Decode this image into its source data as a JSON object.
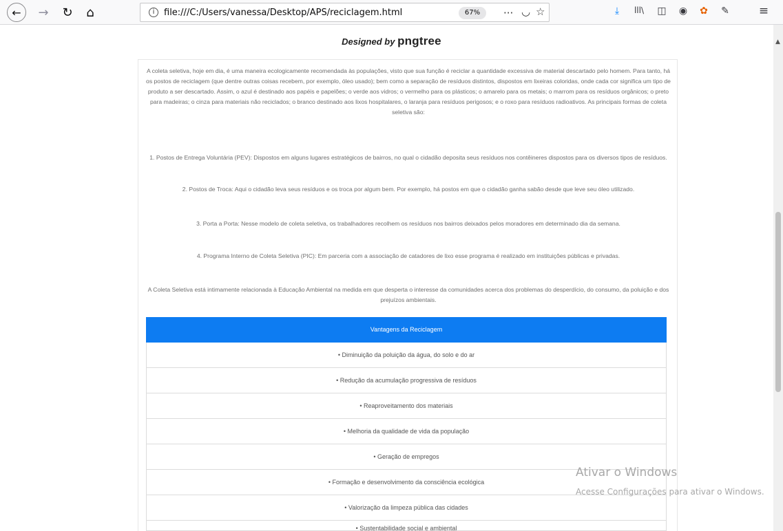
{
  "browser": {
    "back_icon": "←",
    "forward_icon": "→",
    "reload_icon": "↻",
    "home_icon": "⌂",
    "info_icon": "i",
    "url": "file:///C:/Users/vanessa/Desktop/APS/reciclagem.html",
    "zoom": "67%",
    "more_icon": "···",
    "pocket_icon": "◡",
    "bookmark_icon": "☆",
    "download_icon": "⤓",
    "library_icon": "lll\\",
    "sidebar_icon": "◫",
    "account_icon": "◉",
    "colorful_icon": "✿",
    "pen_icon": "✎",
    "menu_icon": "≡"
  },
  "page": {
    "designed_by": "Designed by",
    "brand": "pngtree",
    "intro": "A coleta seletiva, hoje em dia, é uma maneira ecologicamente recomendada às populações, visto que sua função é reciclar a quantidade excessiva de material descartado pelo homem. Para tanto, há os postos de reciclagem (que dentre outras coisas recebem, por exemplo, óleo usado); bem como a separação de resíduos distintos, dispostos em lixeiras coloridas, onde cada cor significa um tipo de produto a ser descartado. Assim, o azul é destinado aos papéis e papelões; o verde aos vidros; o vermelho para os plásticos; o amarelo para os metais; o marrom para os resíduos orgânicos; o preto para madeiras; o cinza para materiais não reciclados; o branco destinado aos lixos hospitalares, o laranja para resíduos perigosos; e o roxo para resíduos radioativos. As principais formas de coleta seletiva são:",
    "item1": "1. Postos de Entrega Voluntária (PEV): Dispostos em alguns lugares estratégicos de bairros, no qual o cidadão deposita seus resíduos nos contêineres dispostos para os diversos tipos de resíduos.",
    "item2": "2. Postos de Troca: Aqui o cidadão leva seus resíduos e os troca por algum bem. Por exemplo, há postos em que o cidadão ganha sabão desde que leve seu óleo utilizado.",
    "item3": "3. Porta a Porta: Nesse modelo de coleta seletiva, os trabalhadores recolhem os resíduos nos bairros deixados pelos moradores em determinado dia da semana.",
    "item4": "4. Programa Interno de Coleta Seletiva (PIC): Em parceria com a associação de catadores de lixo esse programa é realizado em instituições públicas e privadas.",
    "closing": "A Coleta Seletiva está intimamente relacionada à Educação Ambiental na medida em que desperta o interesse da comunidades acerca dos problemas do desperdício, do consumo, da poluição e dos prejuízos ambientais.",
    "advantages_header": "Vantagens da Reciclagem",
    "advantages": [
      "• Diminuição da poluição da água, do solo e do ar",
      "• Redução da acumulação progressiva de resíduos",
      "• Reaproveitamento dos materiais",
      "• Melhoria da qualidade de vida da população",
      "• Geração de empregos",
      "• Formação e desenvolvimento da consciência ecológica",
      "• Valorização da limpeza pública das cidades",
      "• Sustentabilidade social e ambiental"
    ]
  },
  "scrollbar": {
    "up_icon": "▲"
  },
  "watermark": {
    "title": "Ativar o Windows",
    "subtitle": "Acesse Configurações para ativar o Windows."
  }
}
